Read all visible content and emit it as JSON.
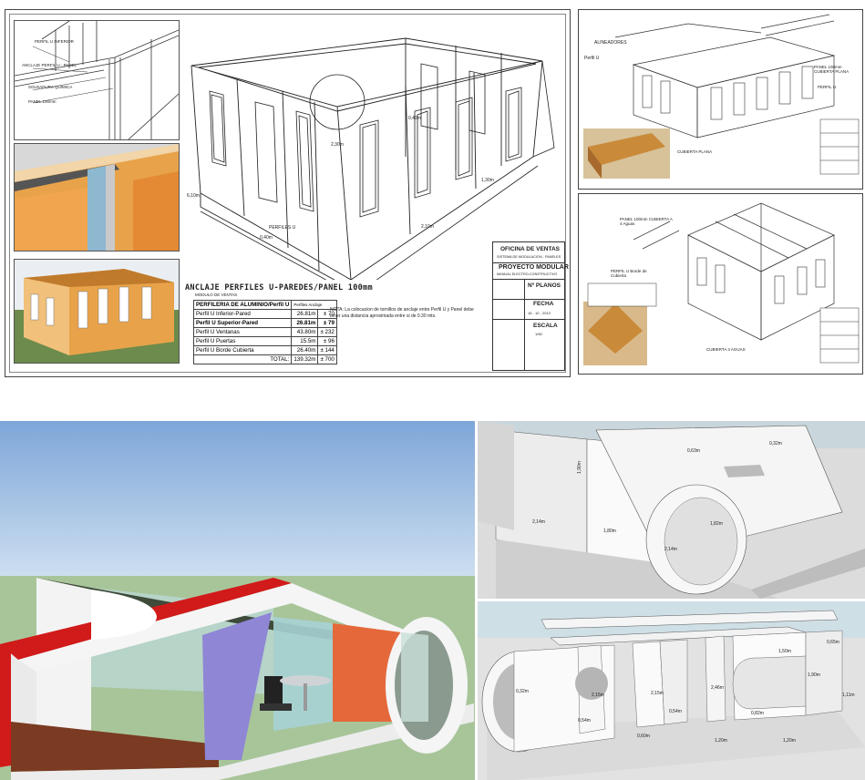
{
  "sheet_main": {
    "title": "ANCLAJE PERFILES U-PAREDES/PANEL 100mm",
    "subtitle": "MODULO DE VENTAS",
    "callouts": [
      "PERFIL U INFERIOR",
      "ANCLAJE PERFIL U - PANEL",
      "SOLDADURA QUIMICA",
      "PANEL 100mm",
      "PERFILES U"
    ],
    "dimensions": [
      "0,40m",
      "2,30m",
      "1,30m",
      "6,10m",
      "0,40m",
      "2,10m",
      "6,10m"
    ],
    "table": {
      "headers": [
        "PERFILERIA DE ALUMINIO/Perfil U",
        "Perfiles Anclaje"
      ],
      "rows": [
        {
          "name": "Perfil U Inferior-Pared",
          "len": "26.81m",
          "qty": "± 70"
        },
        {
          "name": "Perfil U Superior-Pared",
          "len": "26.81m",
          "qty": "± 79"
        },
        {
          "name": "Perfil U Ventanas",
          "len": "43.80m",
          "qty": "± 232"
        },
        {
          "name": "Perfil U Puertas",
          "len": "15.5m",
          "qty": "± 96"
        },
        {
          "name": "Perfil U Borde Cubierta",
          "len": "26.40m",
          "qty": "± 144"
        }
      ],
      "total_label": "TOTAL:",
      "total_len": "139.32m",
      "total_qty": "± 700"
    },
    "note": "NOTA: La colocacion de tornillos de anclaje entre Perfil U y Panel debe tener una distancia aproximada entre si de 0.30 mts.",
    "title_block": {
      "office": "OFICINA DE VENTAS",
      "system": "SISTEMA DE MODULACION - PANELES",
      "project": "PROYECTO MODULAR",
      "project_sub": "MANUAL ELECTRO-CONSTRUCTIVO",
      "planos_label": "Nº PLANOS",
      "fecha_label": "FECHA",
      "fecha": "16 - 10 - 2013",
      "escala_label": "ESCALA",
      "escala": "1/50"
    }
  },
  "sheet_top_right": {
    "callouts": [
      "ALINEADORES",
      "Perfil U",
      "PANEL 100mm CUBIERTA PLANA",
      "PERFIL U",
      "CUBIERTA PLANA"
    ]
  },
  "sheet_mid_right": {
    "callouts": [
      "PANEL 100mm CUBIERTA A 4 Aguas",
      "PERFIL U Borde de Cubierta",
      "CUBIERTA 4 AGUAS"
    ]
  },
  "render_right_top": {
    "dimensions": [
      "1,90m",
      "2,14m",
      "1,80m",
      "0,63m",
      "2,14m",
      "0,32m",
      "1,82m"
    ]
  },
  "render_right_bottom": {
    "dimensions": [
      "1,50m",
      "0,65m",
      "0,32m",
      "2,15m",
      "2,15m",
      "0,54m",
      "2,46m",
      "1,90m",
      "1,20m",
      "0,60m",
      "1,20m",
      "0,82m",
      "1,11m",
      "0,54m"
    ]
  },
  "colors": {
    "sky": "#8eb4e3",
    "grass": "#a8c59a",
    "red_frame": "#d11a1a",
    "purple_panel": "#8f86d6",
    "orange_panel": "#e5683a",
    "wood_floor": "#7a3b22",
    "orange_wall": "#e8a34a"
  }
}
